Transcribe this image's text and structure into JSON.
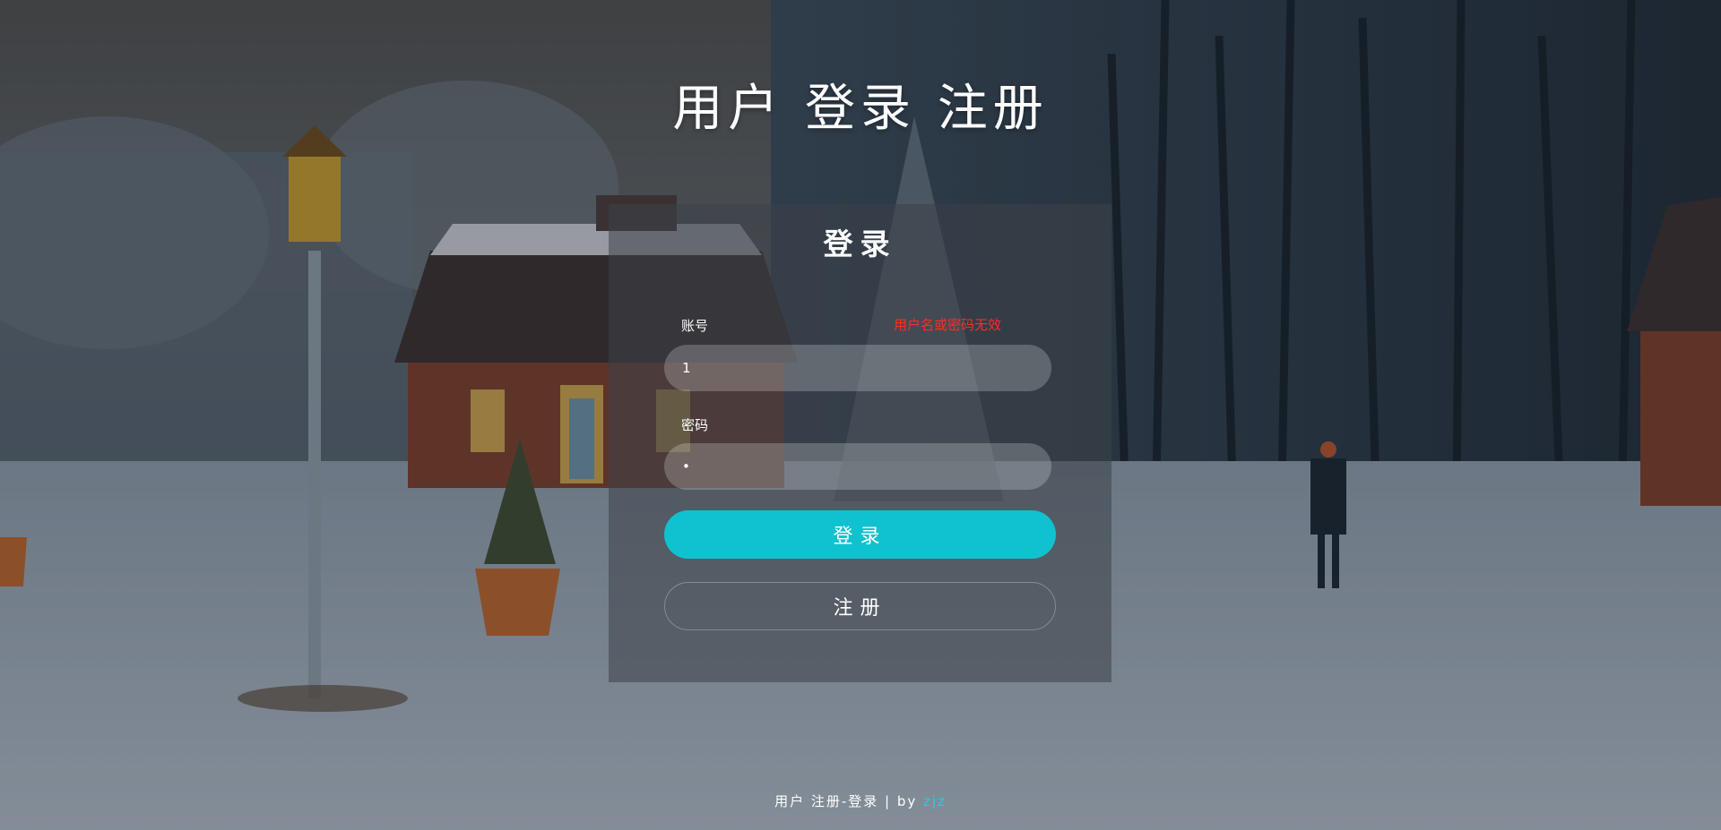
{
  "page": {
    "title": "用户 登录 注册"
  },
  "login": {
    "heading": "登录",
    "account_label": "账号",
    "password_label": "密码",
    "error_message": "用户名或密码无效",
    "account_value": "1",
    "password_value": "1",
    "login_button": "登录",
    "register_button": "注册"
  },
  "footer": {
    "text": "用户 注册-登录 | by ",
    "author": "zjz"
  },
  "colors": {
    "accent": "#10c2cf",
    "error": "#ff2a2a",
    "author_link": "#19d3e0"
  }
}
